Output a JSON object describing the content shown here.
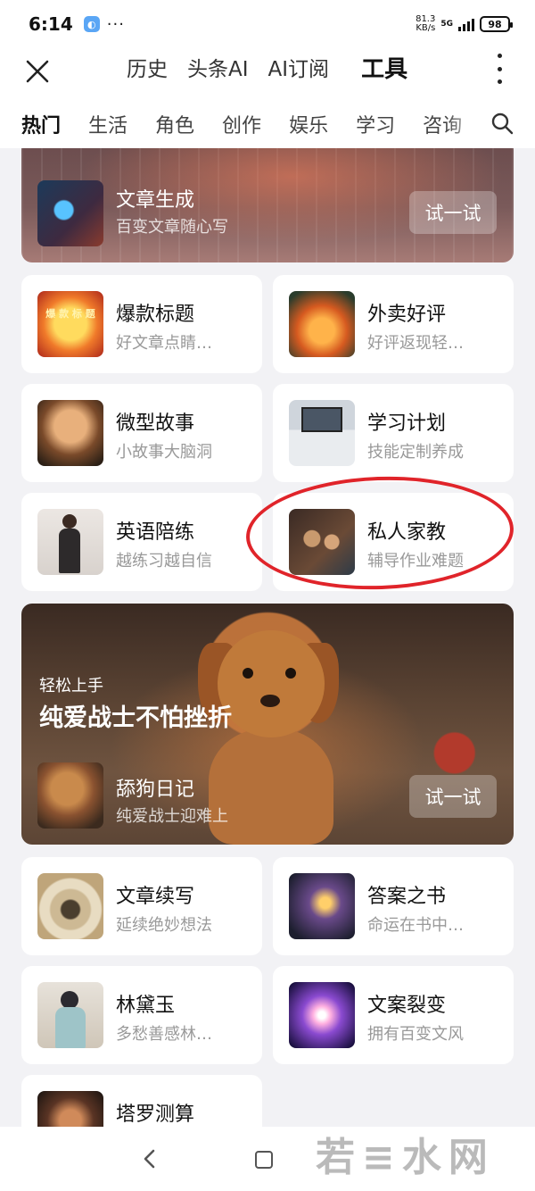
{
  "status_bar": {
    "time": "6:14",
    "dots": "···",
    "net_speed_value": "81.3",
    "net_speed_unit": "KB/s",
    "network": "5G",
    "battery": "98"
  },
  "header": {
    "tabs": [
      {
        "label": "历史"
      },
      {
        "label": "头条AI"
      },
      {
        "label": "AI订阅"
      }
    ],
    "active_tab": "工具"
  },
  "categories": [
    "热门",
    "生活",
    "角色",
    "创作",
    "娱乐",
    "学习",
    "咨询"
  ],
  "banner_top": {
    "title": "文章生成",
    "subtitle": "百变文章随心写",
    "button": "试一试"
  },
  "cards_row1": [
    {
      "title": "爆款标题",
      "subtitle": "好文章点睛…",
      "thumb_text": "爆 款 标 题"
    },
    {
      "title": "外卖好评",
      "subtitle": "好评返现轻…"
    }
  ],
  "cards_row2": [
    {
      "title": "微型故事",
      "subtitle": "小故事大脑洞"
    },
    {
      "title": "学习计划",
      "subtitle": "技能定制养成"
    }
  ],
  "cards_row3": [
    {
      "title": "英语陪练",
      "subtitle": "越练习越自信"
    },
    {
      "title": "私人家教",
      "subtitle": "辅导作业难题"
    }
  ],
  "banner_dog": {
    "eyebrow": "轻松上手",
    "headline": "纯爱战士不怕挫折",
    "title": "舔狗日记",
    "subtitle": "纯爱战士迎难上",
    "button": "试一试"
  },
  "cards_row4": [
    {
      "title": "文章续写",
      "subtitle": "延续绝妙想法"
    },
    {
      "title": "答案之书",
      "subtitle": "命运在书中…"
    }
  ],
  "cards_row5": [
    {
      "title": "林黛玉",
      "subtitle": "多愁善感林…"
    },
    {
      "title": "文案裂变",
      "subtitle": "拥有百变文风"
    }
  ],
  "cards_row6": [
    {
      "title": "塔罗测算",
      "subtitle": ""
    }
  ],
  "watermark": "若≡水网"
}
